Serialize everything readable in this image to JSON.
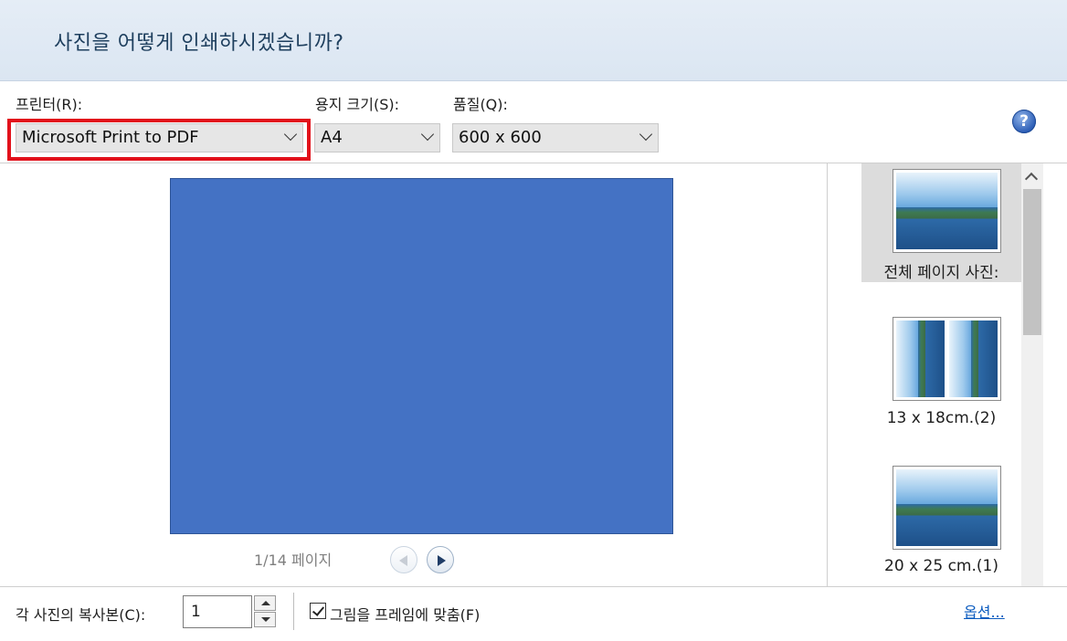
{
  "header": {
    "title": "사진을 어떻게 인쇄하시겠습니까?"
  },
  "printer": {
    "label": "프린터(R):",
    "value": "Microsoft Print to PDF"
  },
  "paper_size": {
    "label": "용지 크기(S):",
    "value": "A4"
  },
  "quality": {
    "label": "품질(Q):",
    "value": "600 x 600"
  },
  "help": {
    "glyph": "?"
  },
  "preview": {
    "page_indicator": "1/14 페이지",
    "page_color": "#4472c4"
  },
  "layouts": [
    {
      "caption": "전체 페이지 사진:",
      "selected": true
    },
    {
      "caption": "13 x 18cm.(2)",
      "selected": false
    },
    {
      "caption": "20 x 25 cm.(1)",
      "selected": false
    }
  ],
  "footer": {
    "copies_label": "각 사진의 복사본(C):",
    "copies_value": "1",
    "fit_label": "그림을 프레임에 맞춤(F)",
    "fit_checked": true,
    "options_link": "옵션..."
  },
  "accent": {
    "highlight_border": "#e2111b"
  }
}
